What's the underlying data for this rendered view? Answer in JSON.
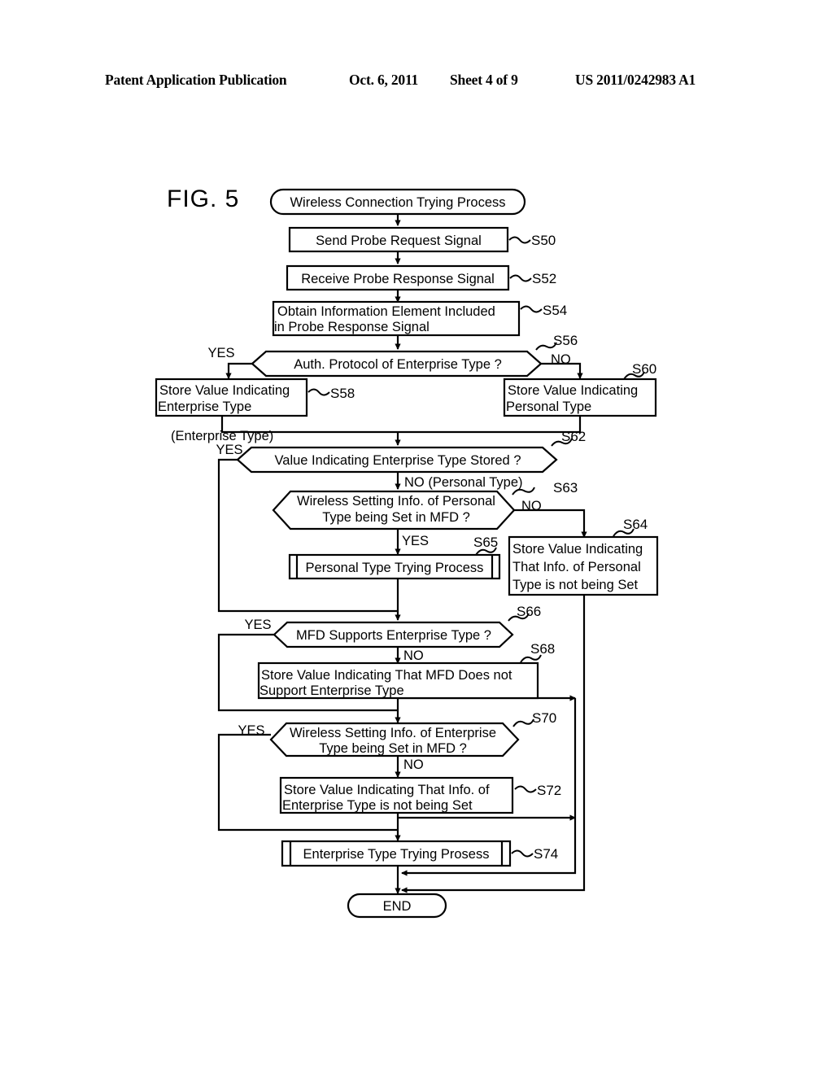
{
  "header": {
    "publication": "Patent Application Publication",
    "date": "Oct. 6, 2011",
    "sheet": "Sheet 4 of 9",
    "number": "US 2011/0242983 A1"
  },
  "figure": {
    "label": "FIG. 5"
  },
  "flowchart": {
    "start": {
      "id": "start",
      "shape": "terminator",
      "text": "Wireless Connection Trying Process"
    },
    "end": {
      "id": "end",
      "shape": "terminator",
      "text": "END"
    },
    "nodes": [
      {
        "id": "S50",
        "shape": "process",
        "step": "S50",
        "lines": [
          "Send Probe Request Signal"
        ]
      },
      {
        "id": "S52",
        "shape": "process",
        "step": "S52",
        "lines": [
          "Receive Probe Response Signal"
        ]
      },
      {
        "id": "S54",
        "shape": "process",
        "step": "S54",
        "lines": [
          "Obtain Information Element Included",
          "in Probe Response Signal"
        ]
      },
      {
        "id": "S56",
        "shape": "decision",
        "step": "S56",
        "lines": [
          "Auth. Protocol of Enterprise Type ?"
        ]
      },
      {
        "id": "S58",
        "shape": "process",
        "step": "S58",
        "lines": [
          "Store Value Indicating",
          "Enterprise Type"
        ]
      },
      {
        "id": "S60",
        "shape": "process",
        "step": "S60",
        "lines": [
          "Store Value Indicating",
          "Personal Type"
        ]
      },
      {
        "id": "S62",
        "shape": "decision",
        "step": "S62",
        "lines": [
          "Value Indicating Enterprise Type Stored ?"
        ]
      },
      {
        "id": "S63",
        "shape": "decision",
        "step": "S63",
        "lines": [
          "Wireless Setting Info. of Personal",
          "Type being Set in MFD ?"
        ]
      },
      {
        "id": "S64",
        "shape": "process",
        "step": "S64",
        "lines": [
          "Store Value Indicating",
          "That Info. of Personal",
          "Type is not being Set"
        ]
      },
      {
        "id": "S65",
        "shape": "predefined",
        "step": "S65",
        "lines": [
          "Personal Type Trying Process"
        ]
      },
      {
        "id": "S66",
        "shape": "decision",
        "step": "S66",
        "lines": [
          "MFD Supports Enterprise Type ?"
        ]
      },
      {
        "id": "S68",
        "shape": "process",
        "step": "S68",
        "lines": [
          "Store Value Indicating That MFD Does not",
          "Support Enterprise Type"
        ]
      },
      {
        "id": "S70",
        "shape": "decision",
        "step": "S70",
        "lines": [
          "Wireless Setting Info. of Enterprise",
          "Type being Set in MFD ?"
        ]
      },
      {
        "id": "S72",
        "shape": "process",
        "step": "S72",
        "lines": [
          "Store Value Indicating That Info. of",
          "Enterprise Type is not being Set"
        ]
      },
      {
        "id": "S74",
        "shape": "predefined",
        "step": "S74",
        "lines": [
          "Enterprise Type Trying Prosess"
        ]
      }
    ],
    "branch_labels": {
      "s56_yes": "YES",
      "s56_no": "NO",
      "s62_note": "(Enterprise Type)",
      "s62_yes": "YES",
      "s62_no": "NO (Personal Type)",
      "s63_no": "NO",
      "s63_yes": "YES",
      "s66_yes": "YES",
      "s66_no": "NO",
      "s70_yes": "YES",
      "s70_no": "NO"
    }
  }
}
